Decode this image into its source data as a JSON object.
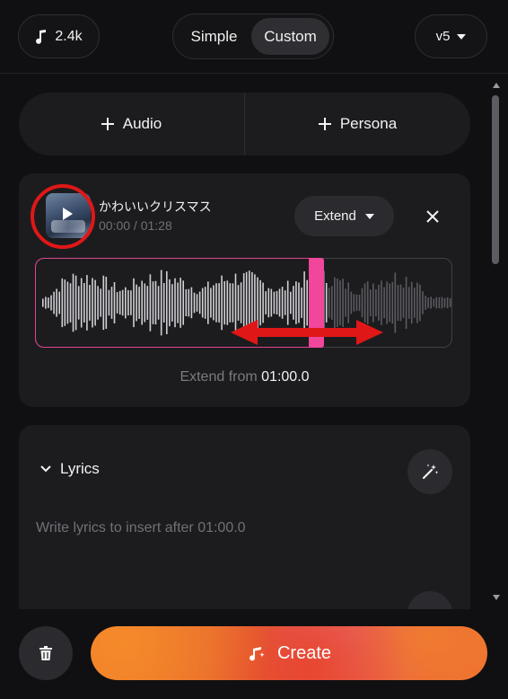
{
  "header": {
    "credits": "2.4k",
    "modes": [
      "Simple",
      "Custom"
    ],
    "active_mode": "Custom",
    "version": "v5"
  },
  "add_row": {
    "audio_label": "Audio",
    "persona_label": "Persona"
  },
  "track": {
    "title": "かわいいクリスマス",
    "time": "00:00 / 01:28",
    "action_label": "Extend",
    "extend_prefix": "Extend from",
    "extend_time": "01:00.0"
  },
  "lyrics": {
    "heading": "Lyrics",
    "placeholder": "Write lyrics to insert after 01:00.0"
  },
  "footer": {
    "create_label": "Create"
  },
  "colors": {
    "accent_pink": "#f0469b",
    "annotation_red": "#e01717",
    "create_orange": "#ee7a2a"
  }
}
